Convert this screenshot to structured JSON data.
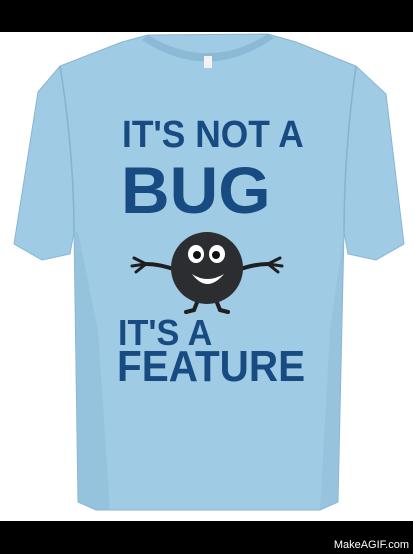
{
  "shirt": {
    "line1": "IT'S NOT A",
    "line2": "BUG",
    "line3": "IT'S A",
    "line4": "FEATURE",
    "shirt_color": "#9fcbe4",
    "print_color": "#174b82"
  },
  "watermark": "MakeAGIF.com"
}
